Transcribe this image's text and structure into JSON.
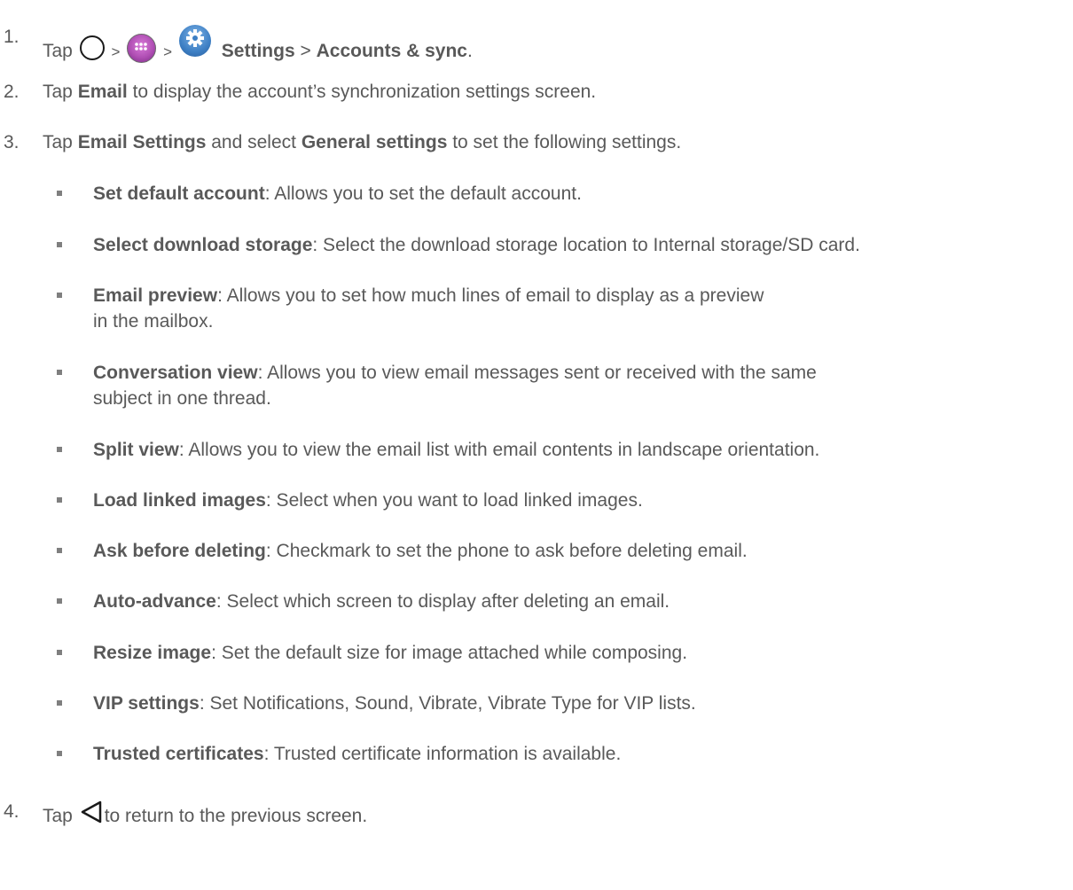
{
  "steps": [
    {
      "number": "1.",
      "tap": "Tap",
      "sep1": ">",
      "sep2": ">",
      "settings": "Settings",
      "sep3": ">",
      "accounts": "Accounts & sync",
      "end": "."
    },
    {
      "number": "2.",
      "pre": "Tap ",
      "bold": "Email",
      "post": " to display the account’s synchronization settings screen."
    },
    {
      "number": "3.",
      "pre": "Tap ",
      "bold1": "Email Settings",
      "mid": " and select ",
      "bold2": "General settings",
      "post": " to set the following settings."
    },
    {
      "number": "4.",
      "pre": "Tap",
      "post": "to return to the previous screen."
    }
  ],
  "settings_list": [
    {
      "term": "Set default account",
      "desc": ": Allows you to set the default account."
    },
    {
      "term": "Select download storage",
      "desc": ": Select the download storage location to Internal storage/SD card."
    },
    {
      "term": "Email preview",
      "desc": ": Allows you to set how much lines of email to display as a preview in the mailbox."
    },
    {
      "term": "Conversation view",
      "desc": ": Allows you to view email messages sent or received with the same subject in one thread."
    },
    {
      "term": "Split view",
      "desc": ": Allows you to view the email list with email contents in landscape orientation."
    },
    {
      "term": "Load linked images",
      "desc": ": Select when you want to load linked images."
    },
    {
      "term": "Ask before deleting",
      "desc": ": Checkmark to set the phone to ask before deleting email."
    },
    {
      "term": "Auto-advance",
      "desc": ": Select which screen to display after deleting an email."
    },
    {
      "term": "Resize image",
      "desc": ": Set the default size for image attached while composing."
    },
    {
      "term": "VIP settings",
      "desc": ": Set Notifications, Sound, Vibrate, Vibrate Type for VIP lists."
    },
    {
      "term": "Trusted certificates",
      "desc": ": Trusted certificate information is available."
    }
  ],
  "icons": {
    "home": "home-circle-icon",
    "apps": "apps-grid-icon",
    "settings": "settings-gear-icon",
    "back": "back-triangle-icon"
  },
  "colors": {
    "text": "#595959",
    "bullet": "#7f7f7f",
    "settings_icon": "#3d7fc4",
    "apps_icon": "#b04fb4"
  }
}
